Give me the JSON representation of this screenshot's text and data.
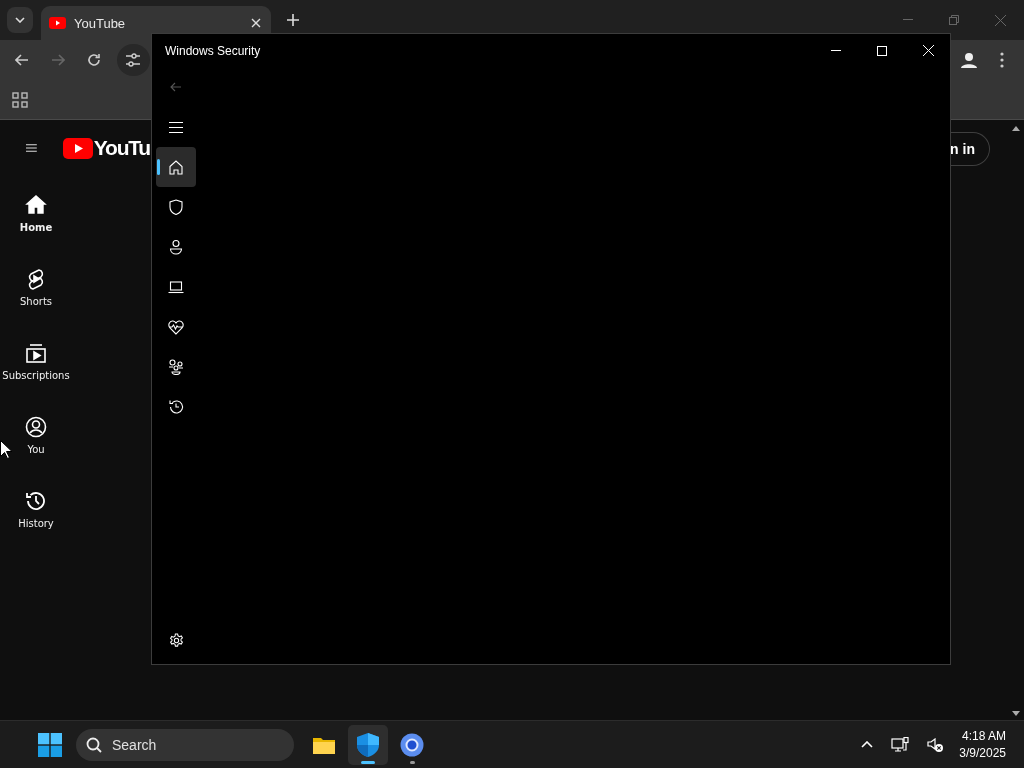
{
  "browser": {
    "tabs": [
      {
        "label": "YouTube",
        "selected": true
      }
    ],
    "forward_disabled": true
  },
  "youtube": {
    "logo": "YouTu",
    "sign_in": "n in",
    "sidebar": [
      {
        "label": "Home",
        "selected": true
      },
      {
        "label": "Shorts",
        "selected": false
      },
      {
        "label": "Subscriptions",
        "selected": false
      },
      {
        "label": "You",
        "selected": false
      },
      {
        "label": "History",
        "selected": false
      }
    ]
  },
  "security_window": {
    "title": "Windows Security",
    "back_disabled": true,
    "nav": [
      {
        "selected": true
      },
      {
        "selected": false
      },
      {
        "selected": false
      },
      {
        "selected": false
      },
      {
        "selected": false
      },
      {
        "selected": false
      },
      {
        "selected": false
      }
    ]
  },
  "taskbar": {
    "search": {
      "placeholder": "Search"
    },
    "apps": [
      {
        "selected": false,
        "running": false
      },
      {
        "selected": true,
        "running": true
      },
      {
        "selected": false,
        "running": true
      }
    ],
    "time": "4:18 AM",
    "date": "3/9/2025"
  }
}
